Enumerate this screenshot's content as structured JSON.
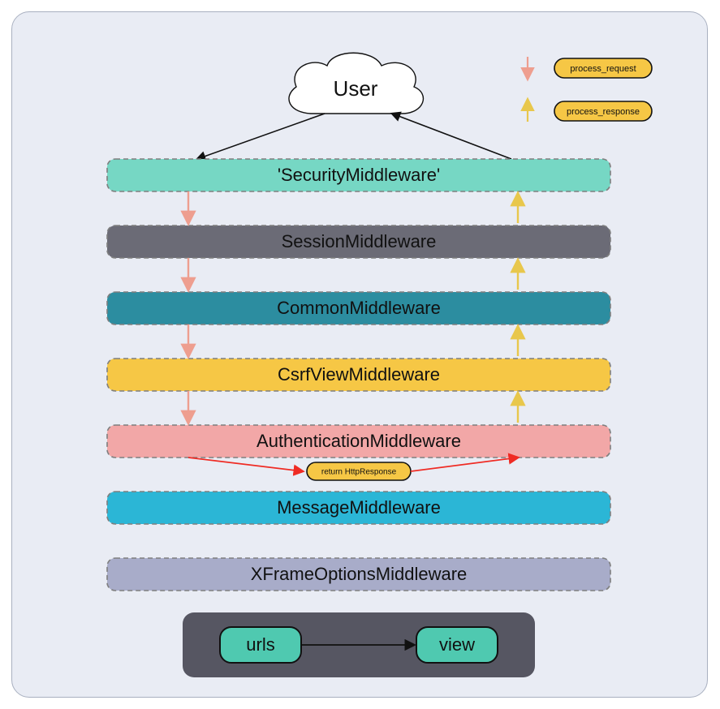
{
  "user_label": "User",
  "middleware": [
    {
      "label": "'SecurityMiddleware'",
      "fill": "#76d7c4"
    },
    {
      "label": "SessionMiddleware",
      "fill": "#6b6b76"
    },
    {
      "label": "CommonMiddleware",
      "fill": "#2c8da0"
    },
    {
      "label": "CsrfViewMiddleware",
      "fill": "#f6c745"
    },
    {
      "label": "AuthenticationMiddleware",
      "fill": "#f2a7a7"
    },
    {
      "label": "MessageMiddleware",
      "fill": "#2bb6d6"
    },
    {
      "label": "XFrameOptionsMiddleware",
      "fill": "#a8acc9"
    }
  ],
  "return_label": "return HttpResponse",
  "routing": {
    "urls_label": "urls",
    "view_label": "view"
  },
  "legend": {
    "request": "process_request",
    "response": "process_response"
  },
  "colors": {
    "dash_border": "#7f7f7f",
    "teal": "#4fc9b0",
    "request_arrow": "#ee9e8f",
    "response_arrow": "#e8c74c",
    "red_arrow": "#ef2b24",
    "black": "#111",
    "pill_fill": "#f6c745",
    "bottom_box": "#565662"
  }
}
